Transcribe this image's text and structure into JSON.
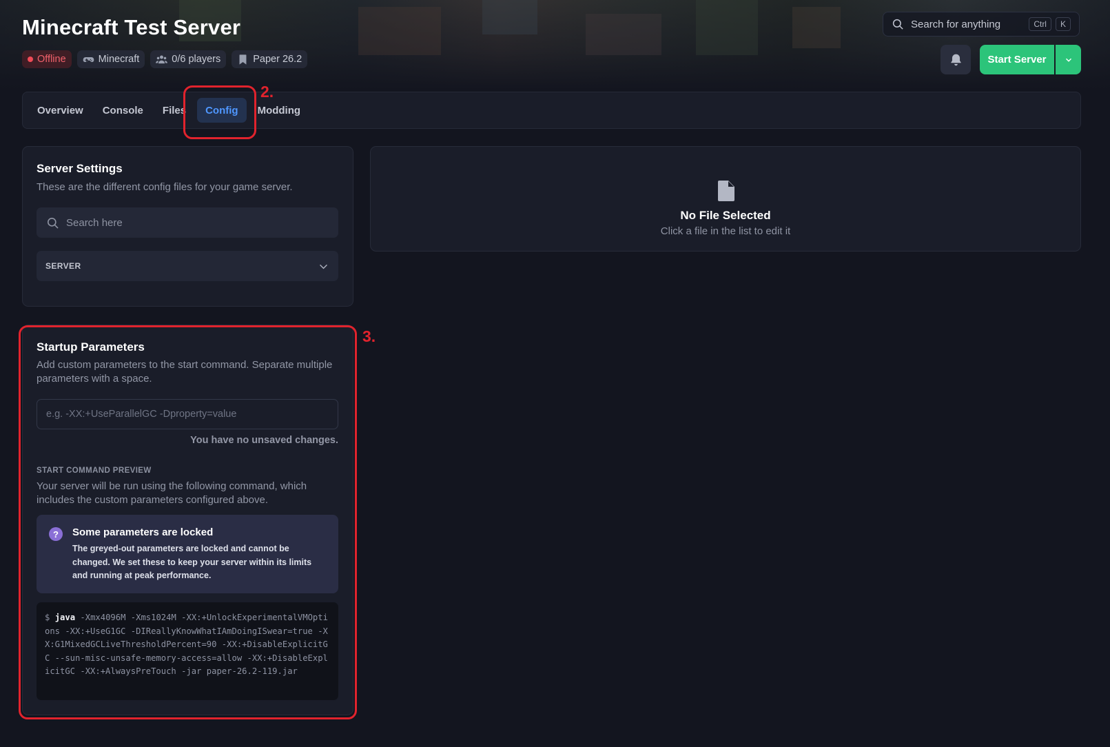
{
  "header": {
    "title": "Minecraft Test Server",
    "badges": {
      "status": "Offline",
      "game": "Minecraft",
      "players": "0/6 players",
      "version": "Paper 26.2"
    },
    "search_label": "Search for anything",
    "shortcut_ctrl": "Ctrl",
    "shortcut_key": "K",
    "start_label": "Start Server"
  },
  "tabs": [
    {
      "label": "Overview"
    },
    {
      "label": "Console"
    },
    {
      "label": "Files"
    },
    {
      "label": "Config"
    },
    {
      "label": "Modding"
    }
  ],
  "active_tab": "Config",
  "annotations": {
    "tab_step": "2.",
    "startup_step": "3."
  },
  "server_settings": {
    "title": "Server Settings",
    "subtitle": "These are the different config files for your game server.",
    "search_placeholder": "Search here",
    "group_label": "SERVER"
  },
  "editor": {
    "empty_title": "No File Selected",
    "empty_hint": "Click a file in the list to edit it"
  },
  "startup": {
    "title": "Startup Parameters",
    "description": "Add custom parameters to the start command. Separate multiple parameters with a space.",
    "input_placeholder": "e.g. -XX:+UseParallelGC -Dproperty=value",
    "save_state": "You have no unsaved changes.",
    "preview_label": "START COMMAND PREVIEW",
    "preview_description": "Your server will be run using the following command, which includes the custom parameters configured above.",
    "locked_title": "Some parameters are locked",
    "locked_text": "The greyed-out parameters are locked and cannot be changed. We set these to keep your server within its limits and running at peak performance.",
    "command_prompt": "$",
    "command_bin": "java",
    "command_args": "-Xmx4096M -Xms1024M -XX:+UnlockExperimentalVMOptions -XX:+UseG1GC -DIReallyKnowWhatIAmDoingISwear=true -XX:G1MixedGCLiveThresholdPercent=90 -XX:+DisableExplicitGC --sun-misc-unsafe-memory-access=allow -XX:+DisableExplicitGC -XX:+AlwaysPreTouch -jar paper-26.2-119.jar"
  },
  "colors": {
    "accent_green": "#2cc47a",
    "accent_blue": "#4f97ff",
    "annotation_red": "#e1232d",
    "offline_red": "#f04b57"
  }
}
